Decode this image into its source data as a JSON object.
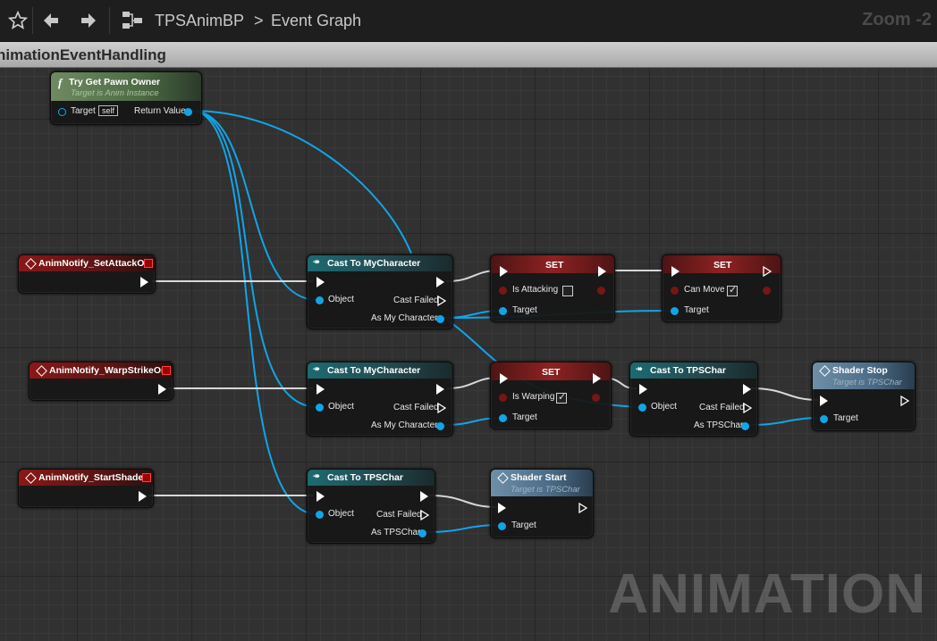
{
  "toolbar": {
    "icons": [
      "star-icon",
      "back-arrow-icon",
      "forward-arrow-icon",
      "blueprint-graph-icon"
    ],
    "breadcrumb_root": "TPSAnimBP",
    "breadcrumb_separator": ">",
    "breadcrumb_current": "Event Graph",
    "zoom": "Zoom -2"
  },
  "comment": {
    "title": "nimationEventHandling"
  },
  "watermark": "ANIMATION",
  "colors": {
    "data_pin": "#10a5e8",
    "exec_pin": "#ffffff",
    "event_header": "#8a1818",
    "cast_header": "#1d6a72",
    "function_header": "#6f8a63"
  },
  "nodes": {
    "try_get_pawn_owner": {
      "title": "Try Get Pawn Owner",
      "subtitle": "Target is Anim Instance",
      "pin_target": "Target",
      "self_value": "self",
      "pin_return": "Return Value"
    },
    "notify_set_attack_off": {
      "title": "AnimNotify_SetAttackOff"
    },
    "notify_warp_strike_on": {
      "title": "AnimNotify_WarpStrikeOn"
    },
    "notify_start_shader": {
      "title": "AnimNotify_StartShader"
    },
    "cast_mychar_1": {
      "title": "Cast To MyCharacter",
      "pin_object": "Object",
      "pin_failed": "Cast Failed",
      "pin_as": "As My Character"
    },
    "cast_mychar_2": {
      "title": "Cast To MyCharacter",
      "pin_object": "Object",
      "pin_failed": "Cast Failed",
      "pin_as": "As My Character"
    },
    "cast_tpschar_1": {
      "title": "Cast To TPSChar",
      "pin_object": "Object",
      "pin_failed": "Cast Failed",
      "pin_as": "As TPSChar"
    },
    "cast_tpschar_2": {
      "title": "Cast To TPSChar",
      "pin_object": "Object",
      "pin_failed": "Cast Failed",
      "pin_as": "As TPSChar"
    },
    "set_attacking": {
      "title": "SET",
      "var": "Is Attacking",
      "checked": false,
      "pin_target": "Target"
    },
    "set_can_move": {
      "title": "SET",
      "var": "Can Move",
      "checked": true,
      "pin_target": "Target"
    },
    "set_warping": {
      "title": "SET",
      "var": "Is Warping",
      "checked": true,
      "pin_target": "Target"
    },
    "shader_stop": {
      "title": "Shader Stop",
      "subtitle": "Target is TPSChar",
      "pin_target": "Target"
    },
    "shader_start": {
      "title": "Shader Start",
      "subtitle": "Target is TPSChar",
      "pin_target": "Target"
    }
  }
}
